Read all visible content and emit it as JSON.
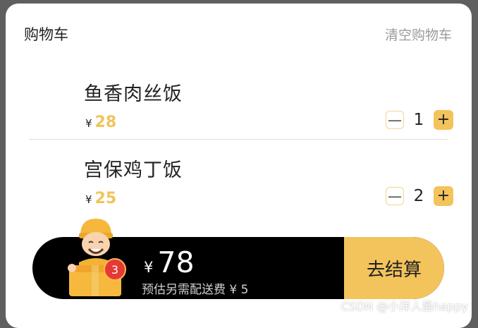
{
  "header": {
    "title": "购物车",
    "clear_label": "清空购物车"
  },
  "items": [
    {
      "name": "鱼香肉丝饭",
      "currency": "¥",
      "price": "28",
      "minus": "—",
      "qty": "1",
      "plus": "+"
    },
    {
      "name": "宫保鸡丁饭",
      "currency": "¥",
      "price": "25",
      "minus": "—",
      "qty": "2",
      "plus": "+"
    }
  ],
  "cart": {
    "badge_count": "3",
    "currency": "¥",
    "total": "78",
    "delivery_note": "预估另需配送费 ¥ 5",
    "checkout_label": "去结算"
  },
  "watermark": "CSDN @小洋人最happy",
  "colors": {
    "accent": "#f3c35c",
    "price": "#f0c45a",
    "bar": "#000000",
    "badge": "#e53935"
  },
  "icons": {
    "mascot": "delivery-courier-icon"
  }
}
